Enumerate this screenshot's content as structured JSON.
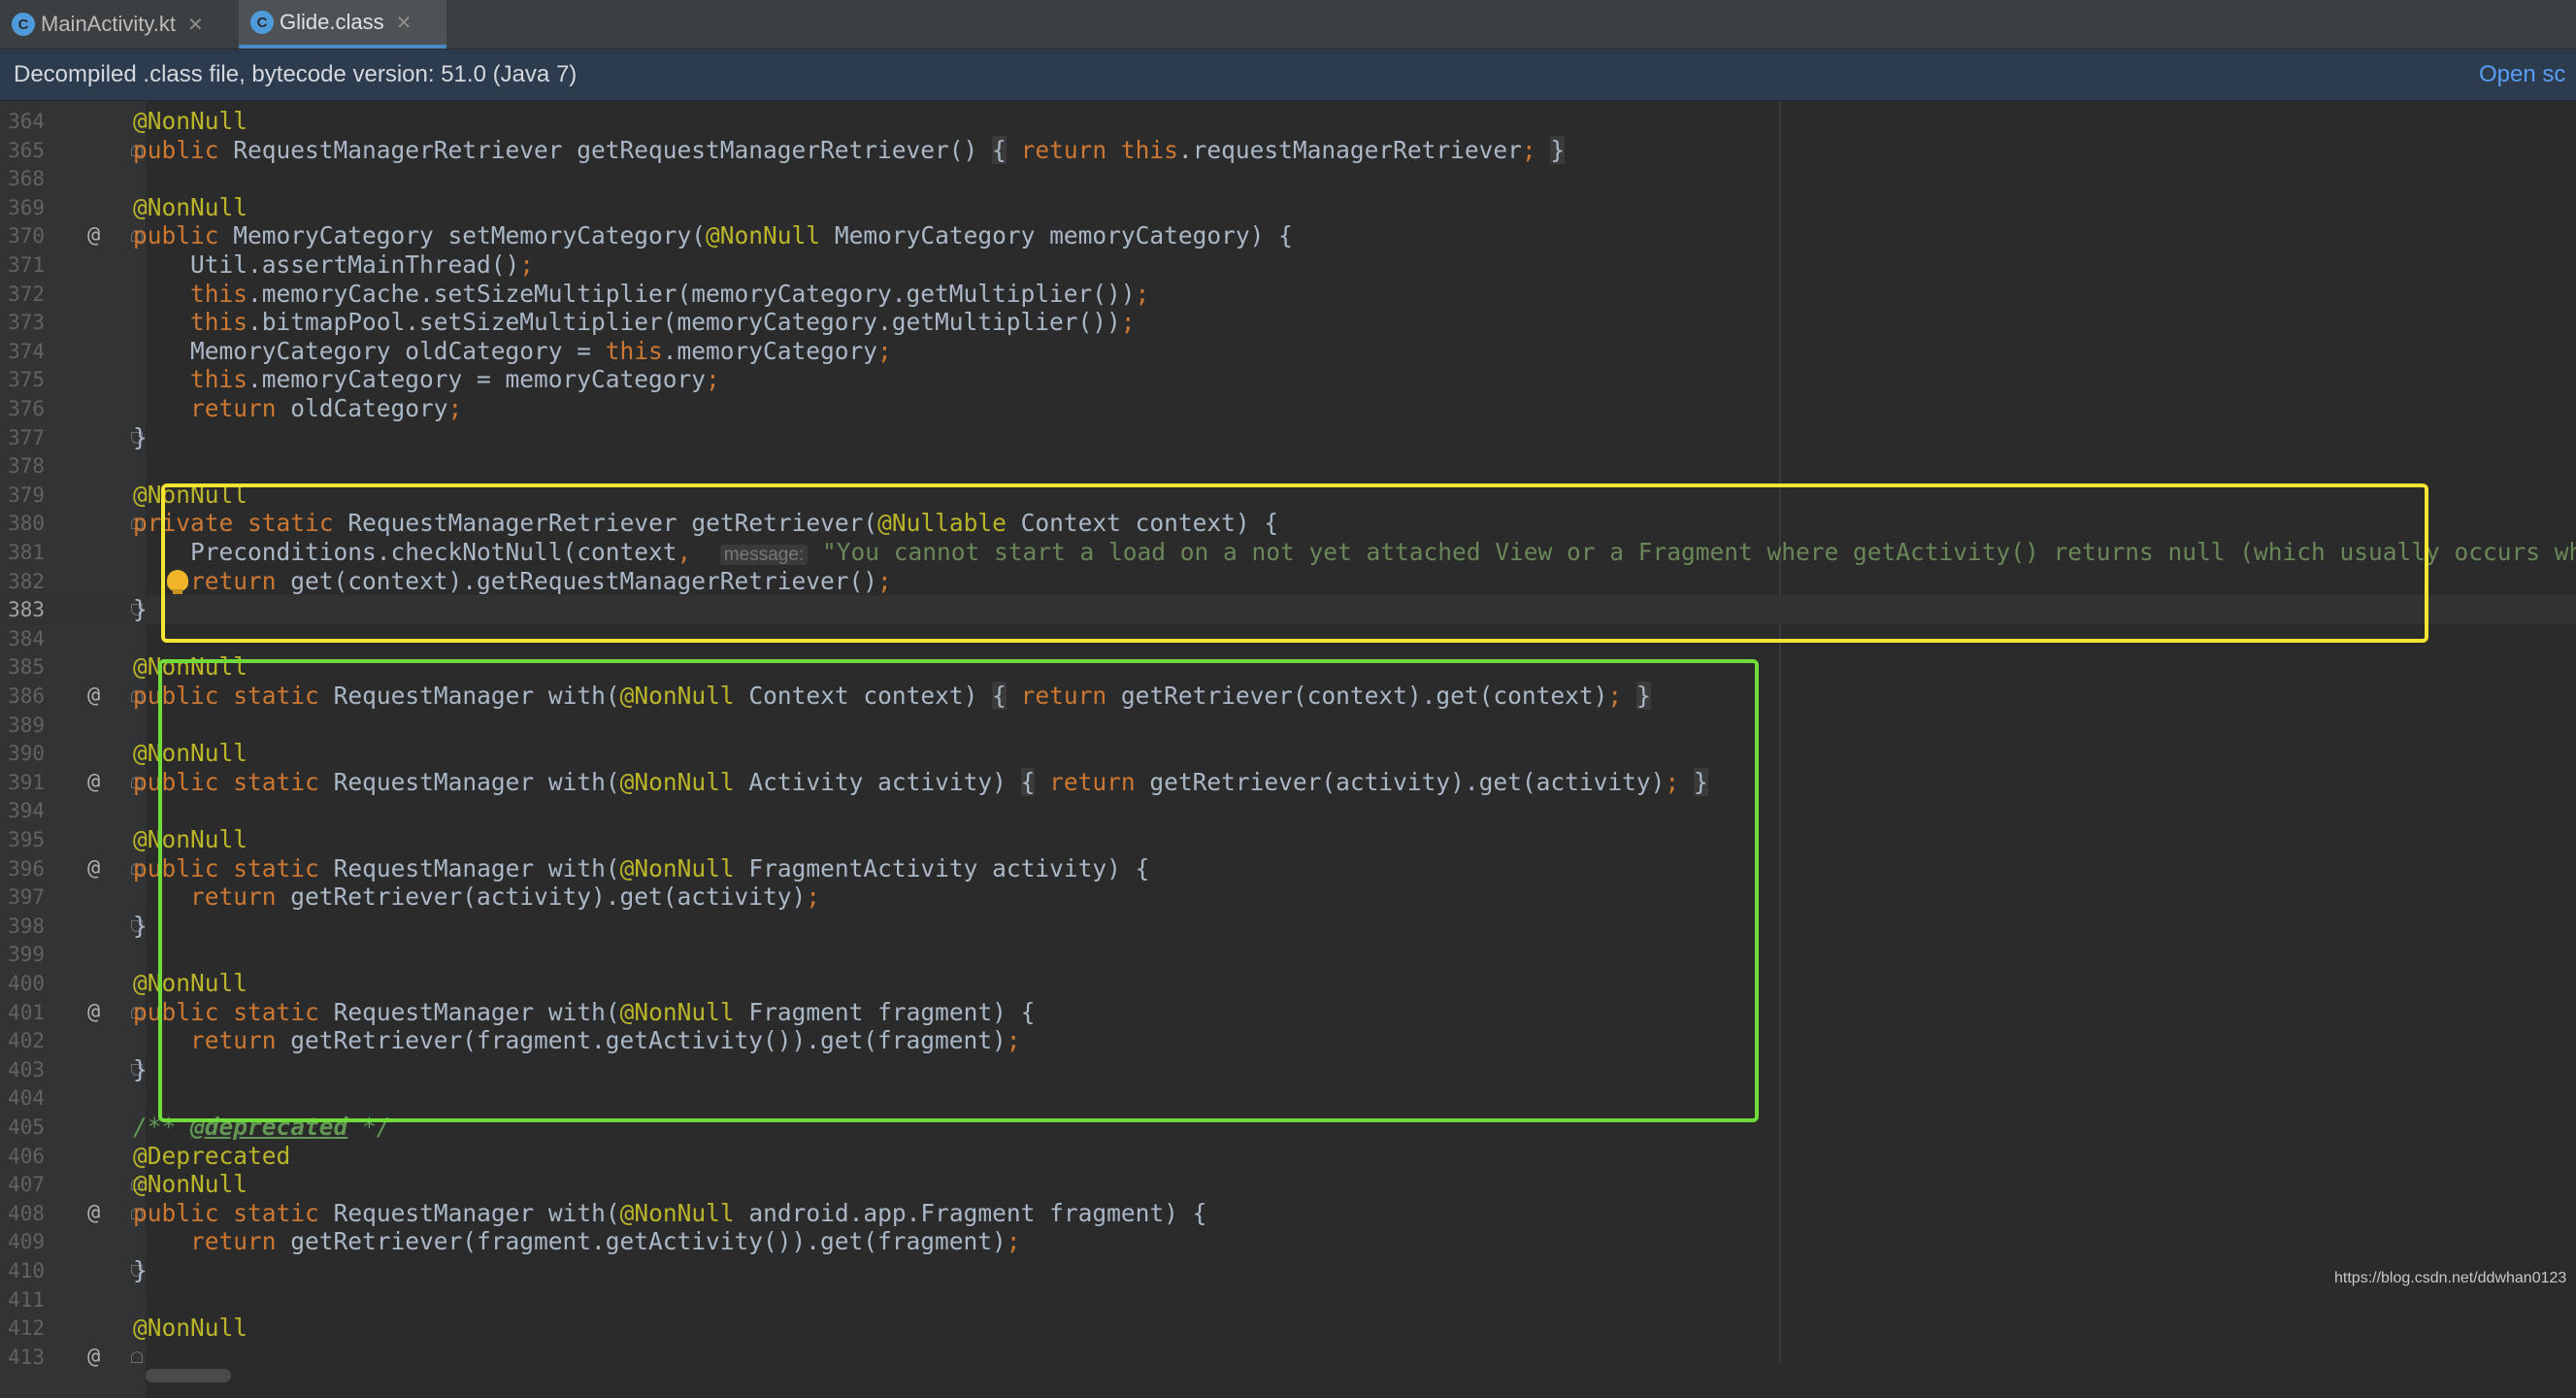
{
  "tabs": [
    {
      "label": "MainActivity.kt",
      "icon": "kotlin-file-icon"
    },
    {
      "label": "Glide.class",
      "icon": "class-file-icon"
    }
  ],
  "banner": {
    "text": "Decompiled .class file, bytecode version: 51.0 (Java 7)",
    "link": "Open sc"
  },
  "colors": {
    "keyword": "#cc7832",
    "string": "#6a8759",
    "annotation": "#bbb529",
    "text": "#a9b7c6",
    "highlight_yellow": "#f5e533",
    "highlight_green": "#6fdc3a"
  },
  "editor": {
    "current_line": "383",
    "partial_top_line": "363",
    "lines": [
      {
        "n": "364",
        "text": "    @NonNull",
        "at": "",
        "fold": ""
      },
      {
        "n": "365",
        "text": "    public RequestManagerRetriever getRequestManagerRetriever() { return this.requestManagerRetriever; }",
        "at": "",
        "fold": "start"
      },
      {
        "n": "368",
        "text": "",
        "at": "",
        "fold": ""
      },
      {
        "n": "369",
        "text": "    @NonNull",
        "at": "",
        "fold": ""
      },
      {
        "n": "370",
        "text": "    public MemoryCategory setMemoryCategory(@NonNull MemoryCategory memoryCategory) {",
        "at": "@",
        "fold": "start"
      },
      {
        "n": "371",
        "text": "        Util.assertMainThread();",
        "at": "",
        "fold": ""
      },
      {
        "n": "372",
        "text": "        this.memoryCache.setSizeMultiplier(memoryCategory.getMultiplier());",
        "at": "",
        "fold": ""
      },
      {
        "n": "373",
        "text": "        this.bitmapPool.setSizeMultiplier(memoryCategory.getMultiplier());",
        "at": "",
        "fold": ""
      },
      {
        "n": "374",
        "text": "        MemoryCategory oldCategory = this.memoryCategory;",
        "at": "",
        "fold": ""
      },
      {
        "n": "375",
        "text": "        this.memoryCategory = memoryCategory;",
        "at": "",
        "fold": ""
      },
      {
        "n": "376",
        "text": "        return oldCategory;",
        "at": "",
        "fold": ""
      },
      {
        "n": "377",
        "text": "    }",
        "at": "",
        "fold": "end"
      },
      {
        "n": "378",
        "text": "",
        "at": "",
        "fold": ""
      },
      {
        "n": "379",
        "text": "    @NonNull",
        "at": "",
        "fold": ""
      },
      {
        "n": "380",
        "text": "    private static RequestManagerRetriever getRetriever(@Nullable Context context) {",
        "at": "",
        "fold": "start"
      },
      {
        "n": "381",
        "text": "        Preconditions.checkNotNull(context,  message: \"You cannot start a load on a not yet attached View or a Fragment where getActivity() returns null (which usually occurs when",
        "at": "",
        "fold": ""
      },
      {
        "n": "382",
        "text": "        return get(context).getRequestManagerRetriever();",
        "at": "",
        "fold": "",
        "bulb": true
      },
      {
        "n": "383",
        "text": "    }",
        "at": "",
        "fold": "end"
      },
      {
        "n": "384",
        "text": "",
        "at": "",
        "fold": ""
      },
      {
        "n": "385",
        "text": "    @NonNull",
        "at": "",
        "fold": ""
      },
      {
        "n": "386",
        "text": "    public static RequestManager with(@NonNull Context context) { return getRetriever(context).get(context); }",
        "at": "@",
        "fold": "start"
      },
      {
        "n": "389",
        "text": "",
        "at": "",
        "fold": ""
      },
      {
        "n": "390",
        "text": "    @NonNull",
        "at": "",
        "fold": ""
      },
      {
        "n": "391",
        "text": "    public static RequestManager with(@NonNull Activity activity) { return getRetriever(activity).get(activity); }",
        "at": "@",
        "fold": "start"
      },
      {
        "n": "394",
        "text": "",
        "at": "",
        "fold": ""
      },
      {
        "n": "395",
        "text": "    @NonNull",
        "at": "",
        "fold": ""
      },
      {
        "n": "396",
        "text": "    public static RequestManager with(@NonNull FragmentActivity activity) {",
        "at": "@",
        "fold": "start"
      },
      {
        "n": "397",
        "text": "        return getRetriever(activity).get(activity);",
        "at": "",
        "fold": ""
      },
      {
        "n": "398",
        "text": "    }",
        "at": "",
        "fold": "end"
      },
      {
        "n": "399",
        "text": "",
        "at": "",
        "fold": ""
      },
      {
        "n": "400",
        "text": "    @NonNull",
        "at": "",
        "fold": ""
      },
      {
        "n": "401",
        "text": "    public static RequestManager with(@NonNull Fragment fragment) {",
        "at": "@",
        "fold": "start"
      },
      {
        "n": "402",
        "text": "        return getRetriever(fragment.getActivity()).get(fragment);",
        "at": "",
        "fold": ""
      },
      {
        "n": "403",
        "text": "    }",
        "at": "",
        "fold": "end"
      },
      {
        "n": "404",
        "text": "",
        "at": "",
        "fold": ""
      },
      {
        "n": "405",
        "text": "    /** @deprecated */",
        "at": "",
        "fold": ""
      },
      {
        "n": "406",
        "text": "    @Deprecated",
        "at": "",
        "fold": ""
      },
      {
        "n": "407",
        "text": "    @NonNull",
        "at": "",
        "fold": "start"
      },
      {
        "n": "408",
        "text": "    public static RequestManager with(@NonNull android.app.Fragment fragment) {",
        "at": "@",
        "fold": "start"
      },
      {
        "n": "409",
        "text": "        return getRetriever(fragment.getActivity()).get(fragment);",
        "at": "",
        "fold": ""
      },
      {
        "n": "410",
        "text": "    }",
        "at": "",
        "fold": "end"
      },
      {
        "n": "411",
        "text": "",
        "at": "",
        "fold": ""
      },
      {
        "n": "412",
        "text": "    @NonNull",
        "at": "",
        "fold": ""
      },
      {
        "n": "413",
        "text": "",
        "at": "@",
        "fold": "start"
      }
    ]
  },
  "watermark": "https://blog.csdn.net/ddwhan0123"
}
